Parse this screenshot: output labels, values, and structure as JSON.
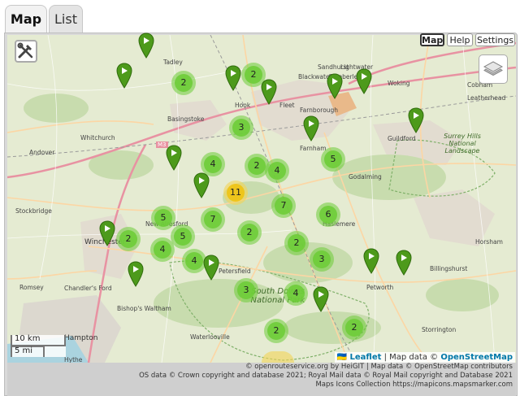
{
  "tabs": [
    {
      "label": "Map"
    },
    {
      "label": "List"
    }
  ],
  "map_buttons": {
    "map": "Map",
    "help": "Help",
    "settings": "Settings"
  },
  "icons": {
    "tools": "tools-icon",
    "layers": "layers-icon",
    "marker": "map-marker-icon"
  },
  "colors": {
    "cluster_small": "#6ecc39",
    "cluster_medium": "#f0c20c",
    "marker": "#4d9a1b"
  },
  "clusters": [
    "2",
    "2",
    "3",
    "4",
    "2",
    "4",
    "5",
    "11",
    "7",
    "6",
    "7",
    "5",
    "2",
    "5",
    "2",
    "4",
    "4",
    "2",
    "3",
    "3",
    "4",
    "2",
    "2"
  ],
  "places": [
    "Tadley",
    "Sandhurst",
    "Lightwater",
    "Blackwater",
    "Camberley",
    "Woking",
    "Cobham",
    "Farnborough",
    "Hook",
    "Fleet",
    "Basingstoke",
    "Leatherhead",
    "Whitchurch",
    "Andover",
    "Guildford",
    "Surrey Hills National Landscape",
    "Farnham",
    "Godalming",
    "Stockbridge",
    "Winchester",
    "New Alresford",
    "Haslemere",
    "Horsham",
    "Romsey",
    "Chandler's Ford",
    "Bishop's Waltham",
    "Petersfield",
    "South Downs National Park",
    "Billingshurst",
    "Petworth",
    "Storrington",
    "Hampton",
    "Hythe",
    "Waterlooville",
    "M3"
  ],
  "scale": {
    "km": "10 km",
    "mi": "5 mi"
  },
  "attribution": {
    "flag": "🇺🇦",
    "leaflet": "Leaflet",
    "sep": " | Map data © ",
    "osm": "OpenStreetMap"
  },
  "footer": {
    "line1": "© openrouteservice.org by HeiGIT | Map data © OpenStreetMap contributors",
    "line2": "OS data © Crown copyright and database 2021; Royal Mail data © Royal Mail copyright and Database 2021",
    "line3": "Maps Icons Collection https://mapicons.mapsmarker.com"
  }
}
